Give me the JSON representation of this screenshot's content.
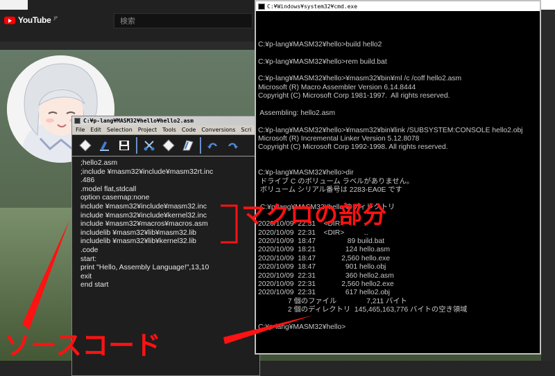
{
  "youtube": {
    "logo_text": "YouTube",
    "logo_region": "JP",
    "search_placeholder": "検索"
  },
  "editor": {
    "title": "C:¥p-lang¥MASM32¥hello¥hello2.asm",
    "menu": [
      "File",
      "Edit",
      "Selection",
      "Project",
      "Tools",
      "Code",
      "Conversions",
      "Scri"
    ],
    "toolbar_icons": [
      "new-file-icon",
      "open-file-icon",
      "save-icon",
      "cut-icon",
      "copy-icon",
      "paste-icon",
      "undo-icon",
      "redo-icon"
    ],
    "code_lines": [
      ";hello2.asm",
      ";include ¥masm32¥include¥masm32rt.inc",
      ".486",
      ".model flat,stdcall",
      "option casemap:none",
      "include ¥masm32¥include¥masm32.inc",
      "include ¥masm32¥include¥kernel32.inc",
      "include ¥masm32¥macros¥macros.asm",
      "includelib ¥masm32¥lib¥masm32.lib",
      "includelib ¥masm32¥lib¥kernel32.lib",
      ".code",
      "start:",
      "print \"Hello, Assembly Language!\",13,10",
      "exit",
      "end start"
    ]
  },
  "console": {
    "title": "C:¥Windows¥system32¥cmd.exe",
    "lines": [
      "",
      "",
      "",
      "C:¥p-lang¥MASM32¥hello>build hello2",
      "",
      "C:¥p-lang¥MASM32¥hello>rem build.bat",
      "",
      "C:¥p-lang¥MASM32¥hello>¥masm32¥bin¥ml /c /coff hello2.asm",
      "Microsoft (R) Macro Assembler Version 6.14.8444",
      "Copyright (C) Microsoft Corp 1981-1997.  All rights reserved.",
      "",
      " Assembling: hello2.asm",
      "",
      "C:¥p-lang¥MASM32¥hello>¥masm32¥bin¥link /SUBSYSTEM:CONSOLE hello2.obj",
      "Microsoft (R) Incremental Linker Version 5.12.8078",
      "Copyright (C) Microsoft Corp 1992-1998. All rights reserved.",
      "",
      "",
      "C:¥p-lang¥MASM32¥hello>dir",
      " ドライブ C のボリューム ラベルがありません。",
      " ボリューム シリアル番号は 2283-EA0E です",
      "",
      " C:¥p-lang¥MASM32¥hello のディレクトリ",
      "",
      "2020/10/09  22:31    <DIR>          .",
      "2020/10/09  22:31    <DIR>          ..",
      "2020/10/09  18:47                89 build.bat",
      "2020/10/09  18:21               124 hello.asm",
      "2020/10/09  18:47             2,560 hello.exe",
      "2020/10/09  18:47               901 hello.obj",
      "2020/10/09  22:31               360 hello2.asm",
      "2020/10/09  22:31             2,560 hello2.exe",
      "2020/10/09  22:31               617 hello2.obj",
      "               7 個のファイル               7,211 バイト",
      "               2 個のディレクトリ  145,465,163,776 バイトの空き領域",
      "",
      "C:¥p-lang¥MASM32¥hello>"
    ]
  },
  "annotations": {
    "macro_label": "マクロの部分",
    "source_label": "ソースコード",
    "color": "#ff1212"
  }
}
